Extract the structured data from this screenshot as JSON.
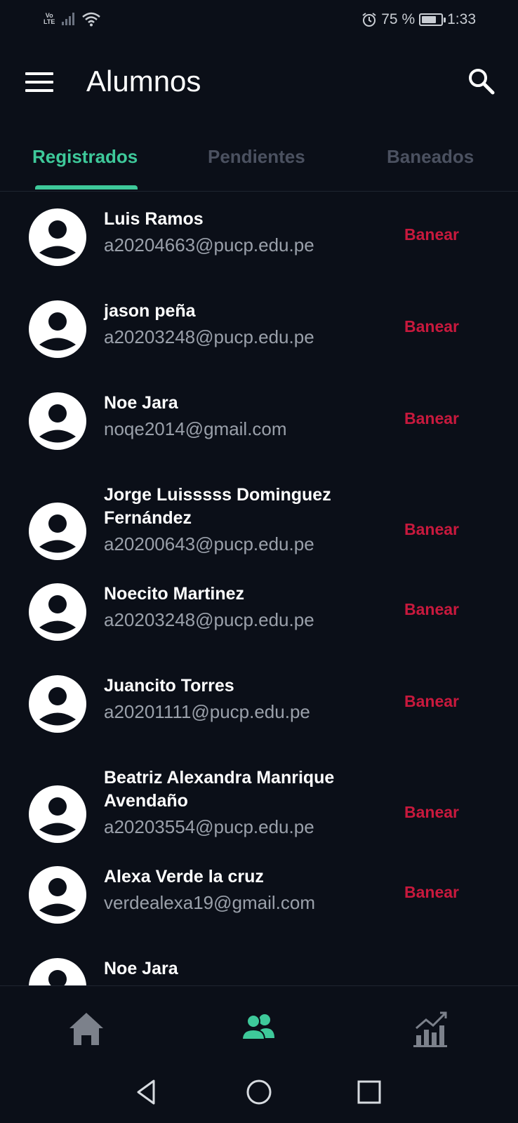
{
  "status_bar": {
    "volte_line1": "Vo",
    "volte_line2": "LTE",
    "battery_percent": "75 %",
    "battery_level": 0.75,
    "time": "1:33",
    "icons": [
      "signal-icon",
      "wifi-icon",
      "alarm-icon",
      "battery-icon"
    ]
  },
  "appbar": {
    "title": "Alumnos",
    "menu_icon": "menu-icon",
    "search_icon": "search-icon"
  },
  "tabs": [
    {
      "label": "Registrados",
      "active": true
    },
    {
      "label": "Pendientes",
      "active": false
    },
    {
      "label": "Baneados",
      "active": false
    }
  ],
  "students": [
    {
      "name": "Luis Ramos",
      "email": "a20204663@pucp.edu.pe",
      "action": "Banear"
    },
    {
      "name": "jason peña",
      "email": "a20203248@pucp.edu.pe",
      "action": "Banear"
    },
    {
      "name": "Noe Jara",
      "email": "noqe2014@gmail.com",
      "action": "Banear"
    },
    {
      "name": "Jorge Luisssss Dominguez Fernández",
      "email": "a20200643@pucp.edu.pe",
      "action": "Banear"
    },
    {
      "name": "Noecito Martinez",
      "email": "a20203248@pucp.edu.pe",
      "action": "Banear"
    },
    {
      "name": "Juancito Torres",
      "email": "a20201111@pucp.edu.pe",
      "action": "Banear"
    },
    {
      "name": "Beatriz Alexandra Manrique Avendaño",
      "email": "a20203554@pucp.edu.pe",
      "action": "Banear"
    },
    {
      "name": "Alexa Verde la cruz",
      "email": "verdealexa19@gmail.com",
      "action": "Banear"
    },
    {
      "name": "Noe Jara",
      "email": "",
      "action": ""
    }
  ],
  "bottom_nav": [
    {
      "icon": "home-icon",
      "active": false
    },
    {
      "icon": "people-icon",
      "active": true
    },
    {
      "icon": "stats-chart-icon",
      "active": false
    }
  ],
  "system_nav": [
    "back-icon",
    "home-circle-icon",
    "recents-icon"
  ],
  "colors": {
    "background": "#0b0f18",
    "accent": "#3ec99a",
    "danger": "#c8193d",
    "muted_text": "#9aa0aa",
    "inactive_tab": "#4b5160"
  }
}
